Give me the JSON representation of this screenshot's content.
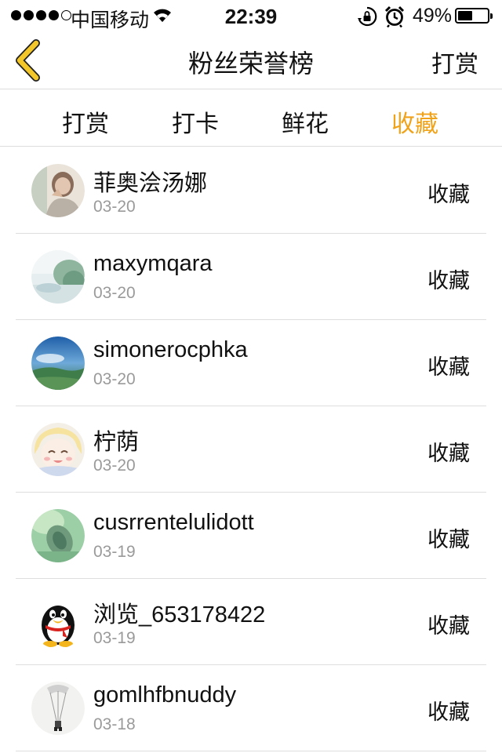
{
  "status_bar": {
    "carrier": "中国移动",
    "time": "22:39",
    "battery_percent": "49%",
    "battery_level": 0.49
  },
  "nav": {
    "title": "粉丝荣誉榜",
    "right_label": "打赏",
    "back_icon": "chevron-left-icon",
    "back_color": "#f3c62a"
  },
  "tabs": [
    {
      "label": "打赏"
    },
    {
      "label": "打卡"
    },
    {
      "label": "鲜花"
    },
    {
      "label": "收藏"
    }
  ],
  "active_tab": "收藏",
  "accent_color": "#f0a31a",
  "fans": [
    {
      "name": "菲奥浍汤娜",
      "date": "03-20",
      "action": "收藏",
      "avatar": "photo-avatar"
    },
    {
      "name": "maxymqara",
      "date": "03-20",
      "action": "收藏",
      "avatar": "landscape-avatar"
    },
    {
      "name": "simonerocphka",
      "date": "03-20",
      "action": "收藏",
      "avatar": "sky-avatar"
    },
    {
      "name": "柠荫",
      "date": "03-20",
      "action": "收藏",
      "avatar": "anime-avatar"
    },
    {
      "name": "cusrrentelulidott",
      "date": "03-19",
      "action": "收藏",
      "avatar": "green-avatar"
    },
    {
      "name": "浏览_653178422",
      "date": "03-19",
      "action": "收藏",
      "avatar": "penguin-avatar"
    },
    {
      "name": "gomlhfbnuddy",
      "date": "03-18",
      "action": "收藏",
      "avatar": "sketch-avatar"
    }
  ]
}
